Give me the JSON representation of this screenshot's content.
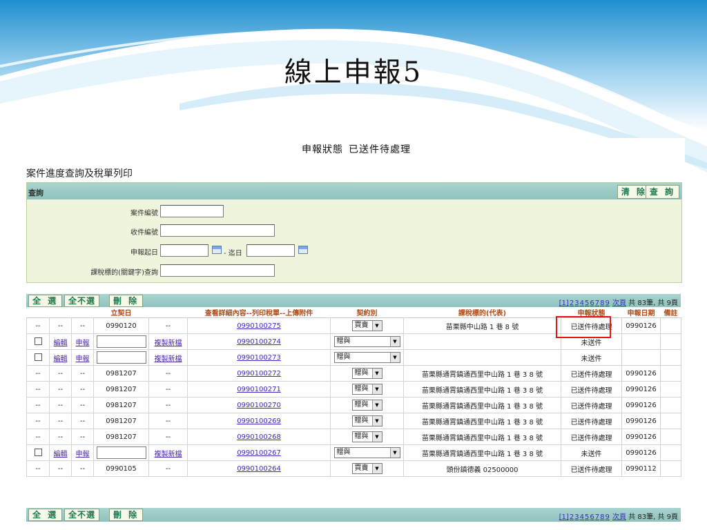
{
  "slide": {
    "title": "線上申報5",
    "status_label": "申報狀態",
    "status_value": "已送件待處理"
  },
  "page_heading": "案件進度查詢及稅單列印",
  "query": {
    "bar_label": "查詢",
    "clear_button": "清 除",
    "search_button": "查 詢",
    "case_no_label": "案件編號",
    "receipt_no_label": "收件編號",
    "date_from_label": "申報起日",
    "date_to_label": "- 迄日",
    "keyword_label": "課稅標的(關鍵字)查詢"
  },
  "toolbar": {
    "select_all": "全 選",
    "select_none": "全不選",
    "delete": "刪 除"
  },
  "pager": {
    "pages": [
      "[1]",
      "2",
      "3",
      "4",
      "5",
      "6",
      "7",
      "8",
      "9"
    ],
    "next": "次頁",
    "summary": "共 83筆, 共 9頁"
  },
  "columns": {
    "contract_date": "立契日",
    "detail": "查看詳細內容--列印稅單--上傳附件",
    "contract_type": "契約別",
    "taxable_object": "課稅標的(代表)",
    "report_status": "申報狀態",
    "report_date": "申報日期",
    "remark": "備註"
  },
  "row_labels": {
    "dash": "--",
    "edit": "編輯",
    "report": "申報",
    "copy_new": "複製新檔"
  },
  "rows": [
    {
      "kind": "submitted",
      "contract_date": "0990120",
      "case_no": "0990100275",
      "contract_type": "買賣",
      "object": "苗栗縣中山路 1 巷 8 號",
      "status": "已送件待處理",
      "report_date": "0990126"
    },
    {
      "kind": "draft",
      "case_no": "0990100274",
      "contract_type": "贈與",
      "object": "",
      "status": "未送件",
      "report_date": ""
    },
    {
      "kind": "draft",
      "case_no": "0990100273",
      "contract_type": "贈與",
      "object": "",
      "status": "未送件",
      "report_date": ""
    },
    {
      "kind": "submitted",
      "contract_date": "0981207",
      "case_no": "0990100272",
      "contract_type": "贈與",
      "object": "苗栗縣通霄鎮通西里中山路 1 巷 3 8 號",
      "status": "已送件待處理",
      "report_date": "0990126"
    },
    {
      "kind": "submitted",
      "contract_date": "0981207",
      "case_no": "0990100271",
      "contract_type": "贈與",
      "object": "苗栗縣通霄鎮通西里中山路 1 巷 3 8 號",
      "status": "已送件待處理",
      "report_date": "0990126"
    },
    {
      "kind": "submitted",
      "contract_date": "0981207",
      "case_no": "0990100270",
      "contract_type": "贈與",
      "object": "苗栗縣通霄鎮通西里中山路 1 巷 3 8 號",
      "status": "已送件待處理",
      "report_date": "0990126"
    },
    {
      "kind": "submitted",
      "contract_date": "0981207",
      "case_no": "0990100269",
      "contract_type": "贈與",
      "object": "苗栗縣通霄鎮通西里中山路 1 巷 3 8 號",
      "status": "已送件待處理",
      "report_date": "0990126"
    },
    {
      "kind": "submitted",
      "contract_date": "0981207",
      "case_no": "0990100268",
      "contract_type": "贈與",
      "object": "苗栗縣通霄鎮通西里中山路 1 巷 3 8 號",
      "status": "已送件待處理",
      "report_date": "0990126"
    },
    {
      "kind": "draft",
      "case_no": "0990100267",
      "contract_type": "贈與",
      "object": "苗栗縣通霄鎮通西里中山路 1 巷 3 8 號",
      "status": "未送件",
      "report_date": "0990126"
    },
    {
      "kind": "submitted",
      "contract_date": "0990105",
      "case_no": "0990100264",
      "contract_type": "買賣",
      "object": "頭份鎮德義 02500000",
      "status": "已送件待處理",
      "report_date": "0990112"
    }
  ],
  "colors": {
    "bar": "#8fc3bd",
    "panel": "#eff5dd",
    "header_text": "#b04a16",
    "link": "#4b24a8",
    "highlight": "#e01818"
  }
}
